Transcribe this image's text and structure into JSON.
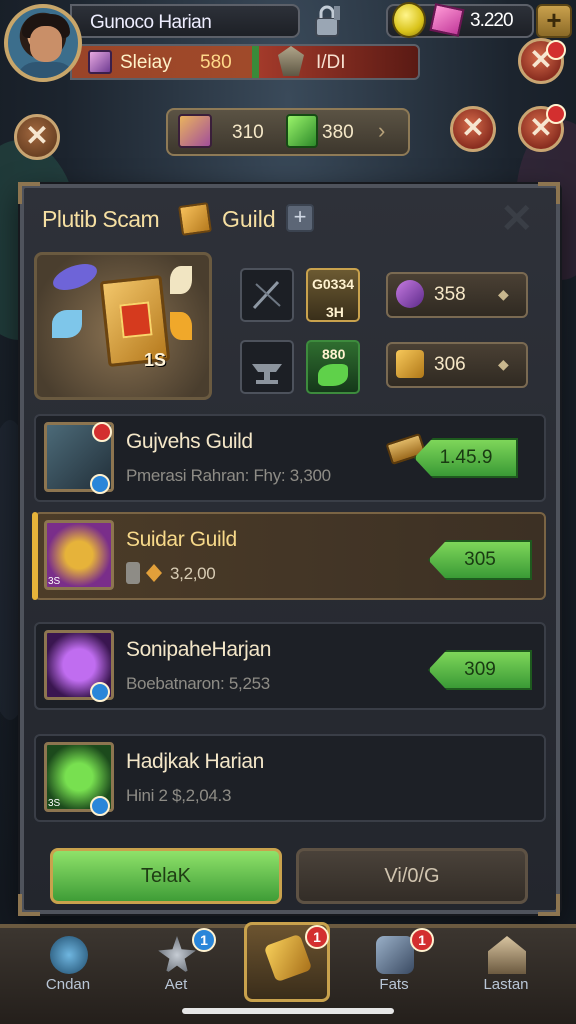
{
  "header": {
    "player_name": "Gunoco Harian",
    "currency_value": "3.220",
    "status_label": "Sleiay",
    "status_value": "580",
    "status_value2": "I/DI"
  },
  "reward_bar": {
    "value1": "310",
    "value2": "380"
  },
  "panel": {
    "title": "Plutib Scam",
    "title_guild": "Guild",
    "add_symbol": "+",
    "hero_count": "1S",
    "slots": [
      {
        "id": "slot-1",
        "text": ""
      },
      {
        "id": "slot-2",
        "text": "G0334\n3H"
      },
      {
        "id": "slot-3",
        "text": ""
      },
      {
        "id": "slot-4",
        "text": "880"
      }
    ],
    "pills": [
      {
        "value": "358"
      },
      {
        "value": "306"
      }
    ]
  },
  "guilds": [
    {
      "name": "Gujvehs Guild",
      "sub": "Pmerasi Rahran: Fhy: 3,300",
      "button": "1.45.9"
    },
    {
      "name": "Suidar Guild",
      "sub": "3,2,00",
      "button": "305"
    },
    {
      "name": "SonipaheHarjan",
      "sub": "Boebatnaron: 5,253",
      "button": "309"
    },
    {
      "name": "Hadjkak Harian",
      "sub": "Hini 2 $,2,04.3",
      "button": ""
    }
  ],
  "icon_labels": {
    "guild2_small": "3S",
    "guild4_small": "3S"
  },
  "actions": {
    "primary": "TelaK",
    "secondary": "Vi/0/G"
  },
  "bottom_nav": [
    {
      "label": "Cndan",
      "badge": ""
    },
    {
      "label": "Aet",
      "badge": "1"
    },
    {
      "label": "",
      "badge": "1"
    },
    {
      "label": "Fats",
      "badge": "1"
    },
    {
      "label": "Lastan",
      "badge": ""
    }
  ],
  "colors": {
    "accent_gold": "#c9a24d",
    "button_green": "#3f9d37",
    "badge_red": "#d32f2f",
    "badge_blue": "#2a86d9"
  }
}
